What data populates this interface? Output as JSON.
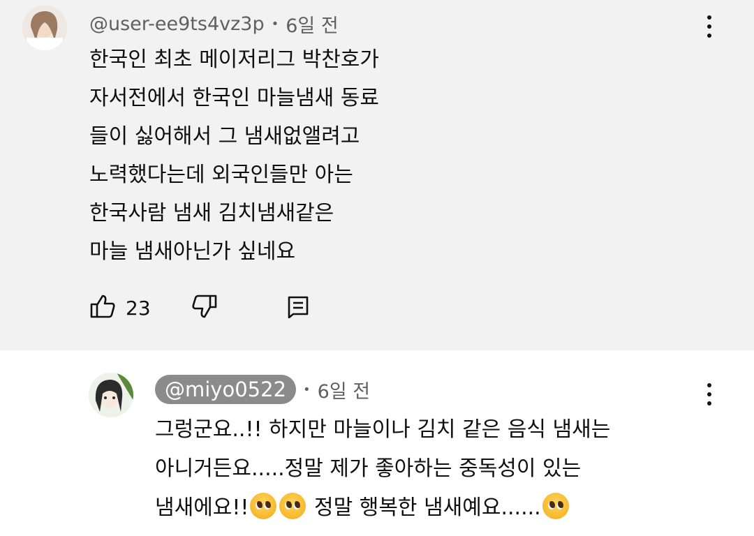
{
  "comments": [
    {
      "handle": "@user-ee9ts4vz3p",
      "time": "6일 전",
      "lines": [
        "한국인 최초 메이저리그 박찬호가",
        "자서전에서 한국인 마늘냄새 동료",
        "들이 싫어해서 그 냄새없앨려고",
        "노력했다는데 외국인들만 아는",
        "한국사람 냄새 김치냄새같은",
        "마늘 냄새아닌가 싶네요"
      ],
      "like_count": "23",
      "icons": {
        "like": "thumbs-up-icon",
        "dislike": "thumbs-down-icon",
        "reply": "reply-icon",
        "more": "more-vertical-icon"
      }
    },
    {
      "handle": "@miyo0522",
      "time": "6일 전",
      "line1": "그렁군요..!! 하지만 마늘이나 김치 같은 음식 냄새는",
      "line2": "아니거든요.....정말 제가 좋아하는 중독성이 있는",
      "line3a": "냄새에요!!",
      "line3b": "정말 행복한 냄새예요......",
      "emoji": "pleading-face-emoji",
      "icons": {
        "more": "more-vertical-icon"
      }
    }
  ],
  "colors": {
    "highlight_bg": "#f2f2f2",
    "meta_text": "#606060",
    "handle_pill": "#8b8b8b"
  }
}
